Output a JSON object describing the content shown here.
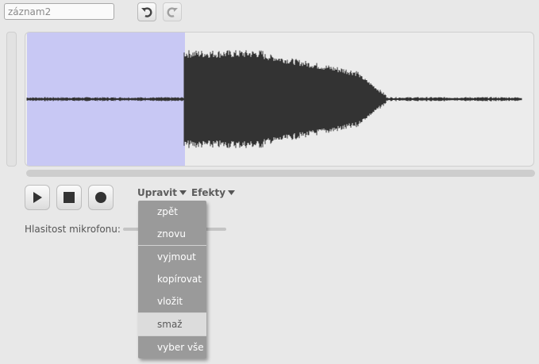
{
  "sound": {
    "name_value": "záznam2"
  },
  "history": {
    "undo_icon": "undo-icon",
    "redo_icon": "redo-icon"
  },
  "playback": {
    "play_icon": "play-icon",
    "stop_icon": "stop-icon",
    "record_icon": "record-icon"
  },
  "menus": {
    "edit_label": "Upravit",
    "effects_label": "Efekty"
  },
  "mic": {
    "label": "Hlasitost mikrofonu:"
  },
  "edit_menu": {
    "items": [
      "zpět",
      "znovu",
      "vyjmout",
      "kopírovat",
      "vložit",
      "smaž",
      "vyber vše"
    ],
    "highlighted": "smaž"
  },
  "colors": {
    "selection": "#c8c8f4",
    "waveform": "#333333",
    "menu_bg": "#9a9a9a",
    "menu_highlight": "#dcdcdc"
  }
}
